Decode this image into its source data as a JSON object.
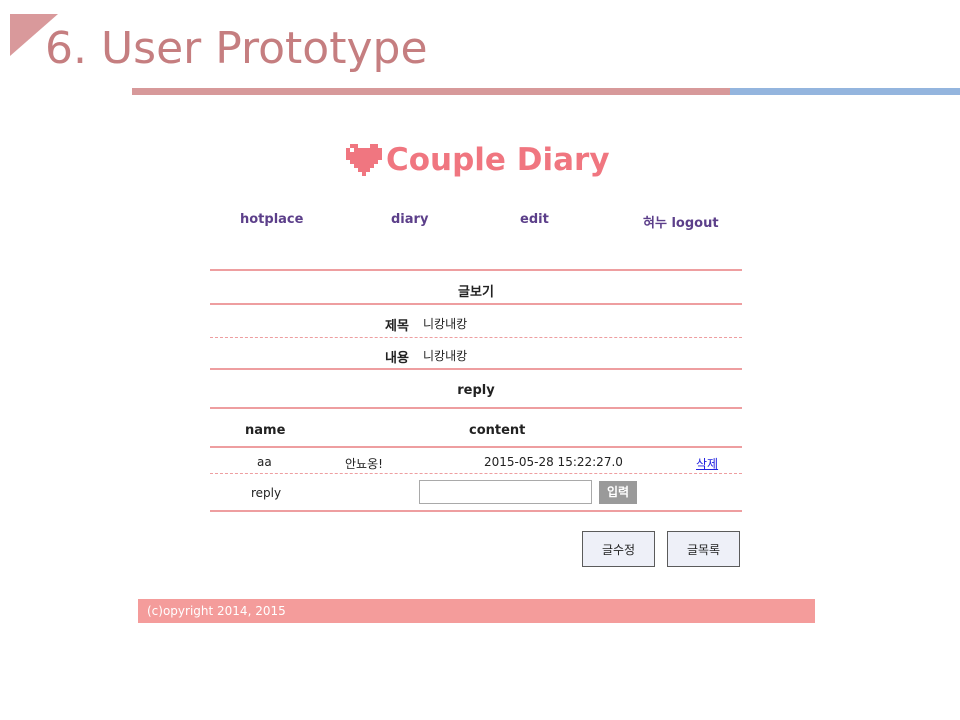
{
  "slide": {
    "title": "6. User Prototype"
  },
  "app": {
    "name": "Couple Diary",
    "icon": "heart-icon",
    "accent": "#f07680"
  },
  "nav": {
    "hotplace": "hotplace",
    "diary": "diary",
    "edit": "edit",
    "logout": "혀누 logout"
  },
  "view": {
    "section_title": "글보기",
    "subject_label": "제목",
    "subject_value": "니캉내캉",
    "content_label": "내용",
    "content_value": "니캉내캉"
  },
  "reply": {
    "section_title": "reply",
    "col_name": "name",
    "col_content": "content",
    "rows": [
      {
        "name": "aa",
        "content": "안뇨옹!",
        "date": "2015-05-28 15:22:27.0",
        "delete": "삭제"
      }
    ],
    "input_label": "reply",
    "input_value": "",
    "submit": "입력"
  },
  "buttons": {
    "edit_post": "글수정",
    "post_list": "글목록"
  },
  "footer": {
    "text": "(c)opyright 2014, 2015"
  }
}
